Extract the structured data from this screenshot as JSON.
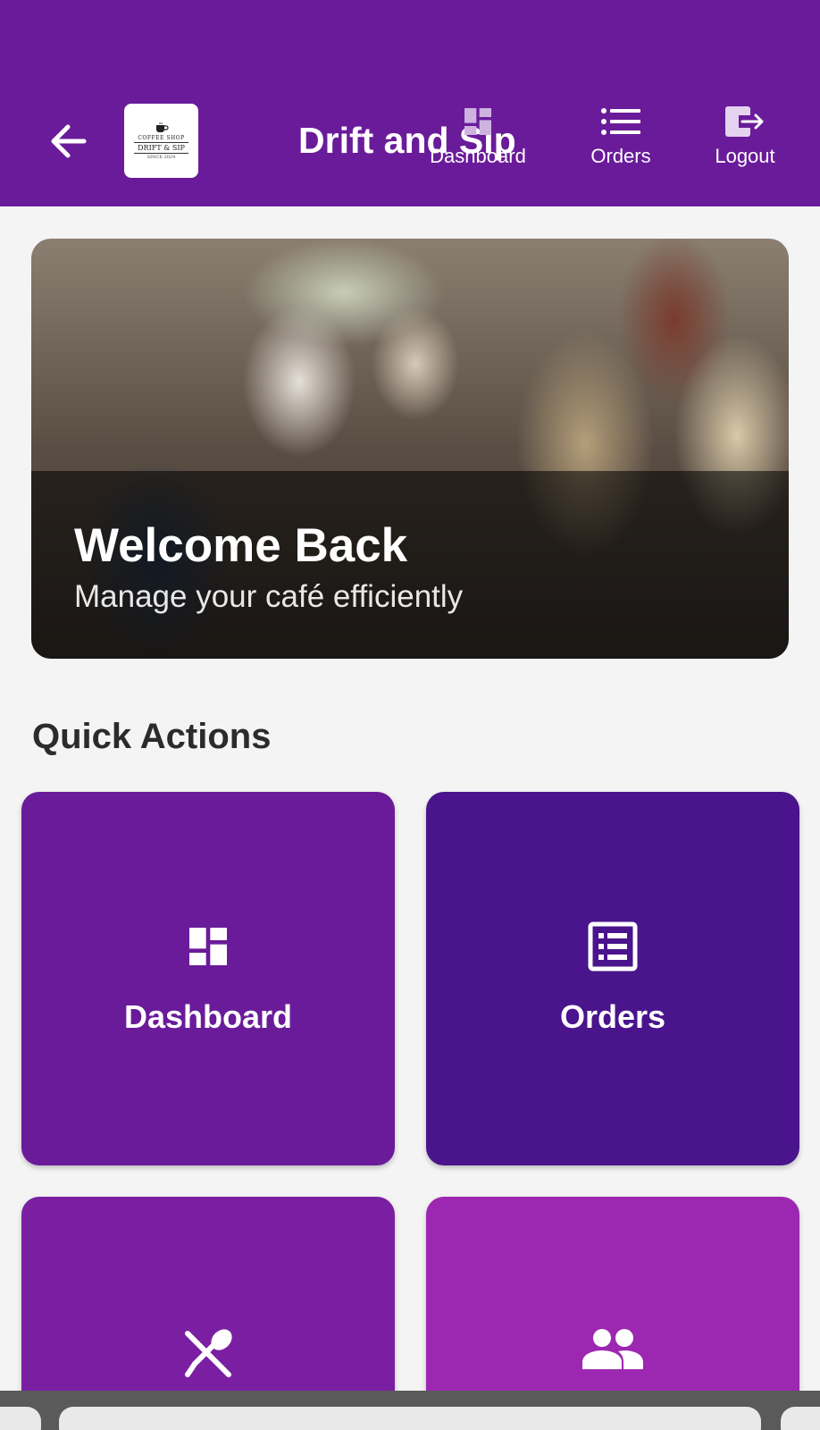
{
  "app_bar": {
    "title": "Drift and Sip",
    "logo": {
      "top_text": "COFFEE SHOP",
      "brand": "DRIFT & SIP",
      "bottom_text": "SINCE 2024"
    },
    "nav": [
      {
        "label": "Dashboard",
        "icon": "dashboard-icon"
      },
      {
        "label": "Orders",
        "icon": "list-icon"
      },
      {
        "label": "Logout",
        "icon": "logout-icon"
      }
    ],
    "background_color": "#6a1b9a"
  },
  "hero": {
    "title": "Welcome Back",
    "subtitle": "Manage your café efficiently"
  },
  "quick_actions": {
    "title": "Quick Actions",
    "cards": [
      {
        "label": "Dashboard",
        "icon": "dashboard-icon",
        "color": "#6a1b9a"
      },
      {
        "label": "Orders",
        "icon": "orders-list-icon",
        "color": "#4a148c"
      },
      {
        "label": "",
        "icon": "utensils-icon",
        "color": "#7b1fa2"
      },
      {
        "label": "",
        "icon": "people-icon",
        "color": "#9c27b0"
      }
    ]
  }
}
